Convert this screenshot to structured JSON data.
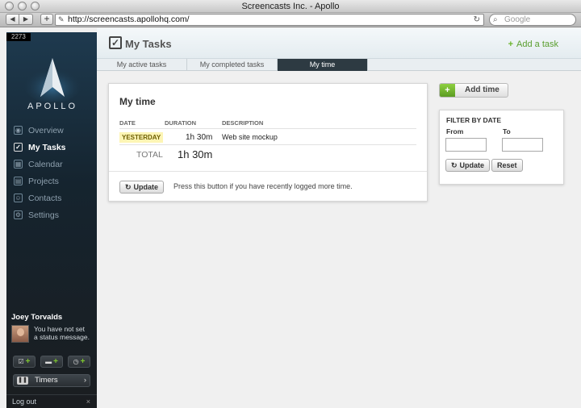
{
  "window": {
    "title": "Screencasts Inc. - Apollo"
  },
  "browser": {
    "back_icon": "◀",
    "forward_icon": "▶",
    "new_tab_icon": "+",
    "url": "http://screencasts.apollohq.com/",
    "search_placeholder": "Google"
  },
  "sidebar": {
    "counter": "2273",
    "logo_text": "APOLLO",
    "nav": [
      {
        "label": "Overview",
        "icon": "eye-icon",
        "glyph": "◉",
        "active": false
      },
      {
        "label": "My Tasks",
        "icon": "checkbox-icon",
        "glyph": "✓",
        "active": true
      },
      {
        "label": "Calendar",
        "icon": "calendar-icon",
        "glyph": "▦",
        "active": false
      },
      {
        "label": "Projects",
        "icon": "projects-icon",
        "glyph": "▤",
        "active": false
      },
      {
        "label": "Contacts",
        "icon": "contacts-icon",
        "glyph": "☺",
        "active": false
      },
      {
        "label": "Settings",
        "icon": "settings-icon",
        "glyph": "⚙",
        "active": false
      }
    ],
    "user": {
      "name": "Joey Torvalds",
      "status": "You have not set a status message."
    },
    "quick_add_glyph": "+",
    "timers_label": "Timers",
    "logout_label": "Log out",
    "logout_close": "×"
  },
  "header": {
    "title": "My Tasks",
    "add_task_label": "Add a task",
    "add_task_glyph": "+"
  },
  "tabs": [
    {
      "label": "My active tasks",
      "active": false
    },
    {
      "label": "My completed tasks",
      "active": false
    },
    {
      "label": "My time",
      "active": true
    }
  ],
  "my_time": {
    "title": "My time",
    "columns": {
      "date": "DATE",
      "duration": "DURATION",
      "description": "DESCRIPTION"
    },
    "rows": [
      {
        "date": "YESTERDAY",
        "duration": "1h 30m",
        "description": "Web site mockup"
      }
    ],
    "total_label": "TOTAL",
    "total_value": "1h 30m",
    "update_label": "Update",
    "update_note": "Press this button if you have recently logged more time."
  },
  "add_time": {
    "label": "Add time",
    "glyph": "+"
  },
  "filter": {
    "title": "FILTER BY DATE",
    "from_label": "From",
    "to_label": "To",
    "from_value": "",
    "to_value": "",
    "update_label": "Update",
    "reset_label": "Reset"
  },
  "colors": {
    "accent_green": "#6bb52d",
    "sidebar_dark": "#1a1d20",
    "active_tab": "#2d3a42"
  }
}
